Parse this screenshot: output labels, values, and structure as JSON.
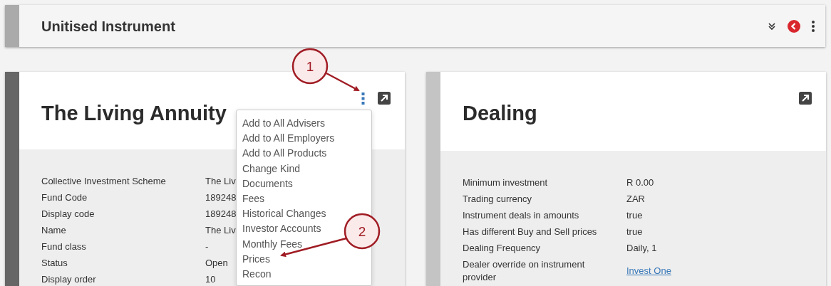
{
  "header": {
    "title": "Unitised Instrument"
  },
  "cards": [
    {
      "title": "The Living Annuity",
      "has_menu": true,
      "color": "#666666",
      "rows": [
        {
          "label": "Collective Investment Scheme",
          "value": "The Liv"
        },
        {
          "label": "Fund Code",
          "value": "189248"
        },
        {
          "label": "Display code",
          "value": "189248"
        },
        {
          "label": "Name",
          "value": "The Liv"
        },
        {
          "label": "Fund class",
          "value": "-"
        },
        {
          "label": "Status",
          "value": "Open"
        },
        {
          "label": "Display order",
          "value": "10"
        }
      ]
    },
    {
      "title": "Dealing",
      "has_menu": false,
      "color": "#c4c4c4",
      "rows": [
        {
          "label": "Minimum investment",
          "value": "R 0.00"
        },
        {
          "label": "Trading currency",
          "value": "ZAR"
        },
        {
          "label": "Instrument deals in amounts",
          "value": "true"
        },
        {
          "label": "Has different Buy and Sell prices",
          "value": "true"
        },
        {
          "label": "Dealing Frequency",
          "value": "Daily, 1"
        },
        {
          "label": "Dealer override on instrument provider",
          "value": "Invest One",
          "kind": "link"
        }
      ]
    }
  ],
  "menu": {
    "items": [
      "Add to All Advisers",
      "Add to All Employers",
      "Add to All Products",
      "Change Kind",
      "Documents",
      "Fees",
      "Historical Changes",
      "Investor Accounts",
      "Monthly Fees",
      "Prices",
      "Recon"
    ]
  },
  "callouts": [
    "1",
    "2"
  ]
}
